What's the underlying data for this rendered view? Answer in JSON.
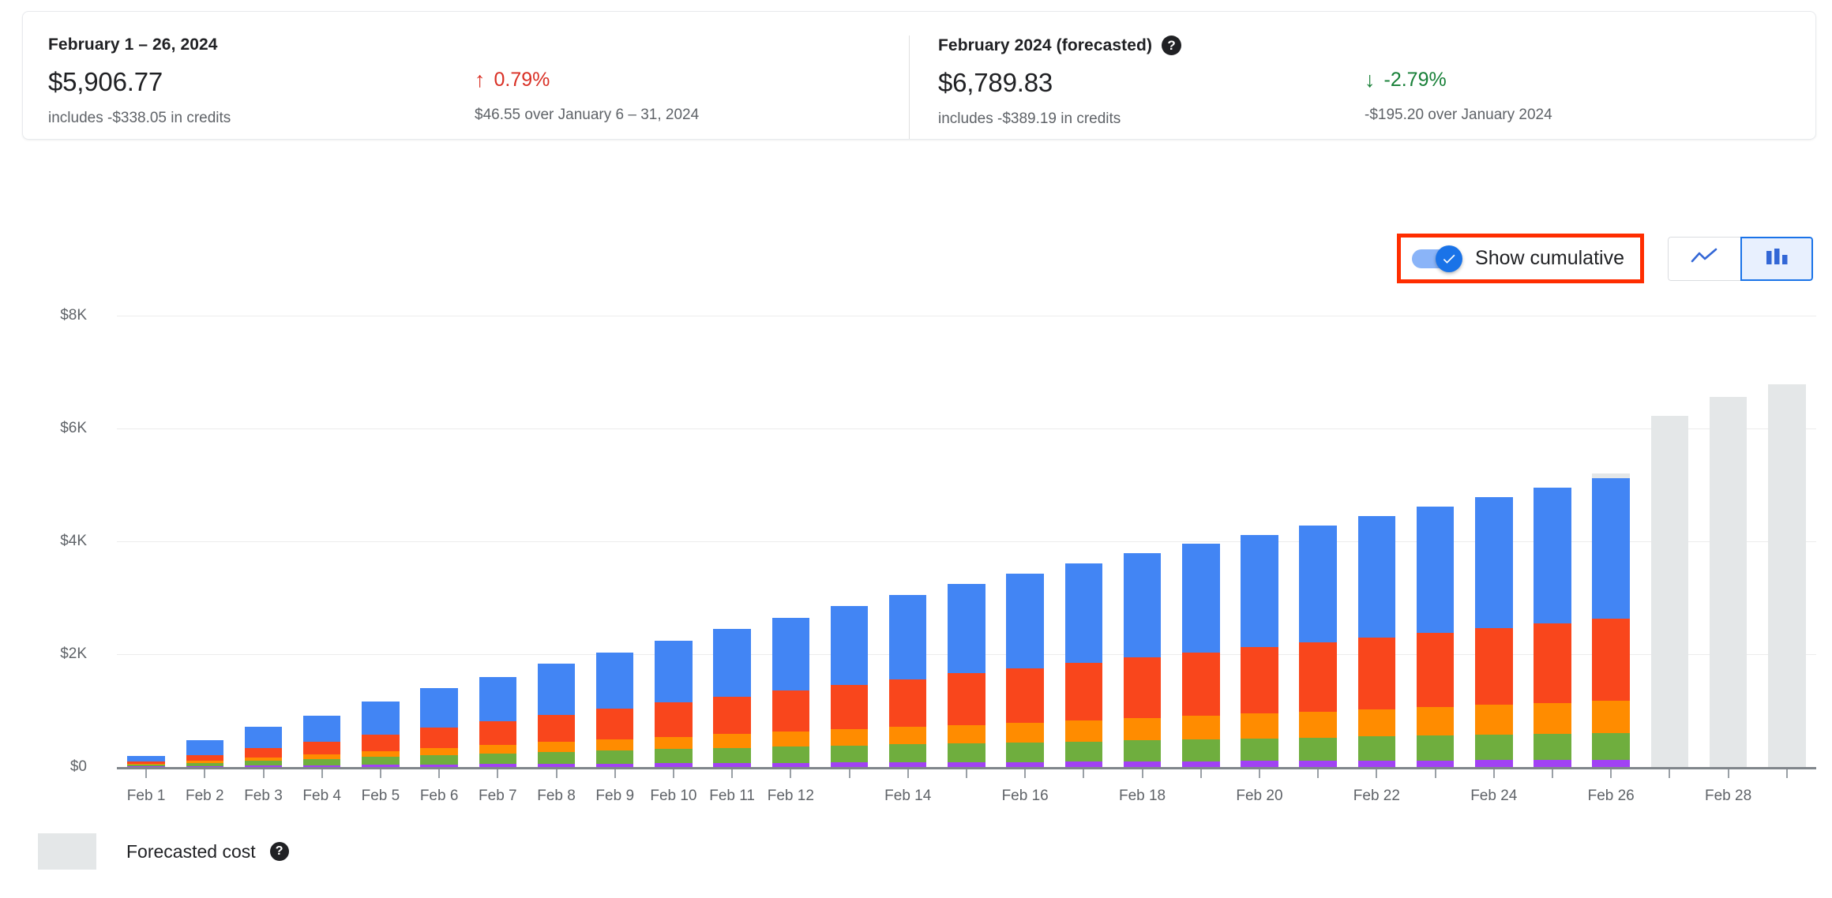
{
  "summary": {
    "actual": {
      "title": "February 1 – 26, 2024",
      "amount": "$5,906.77",
      "credits": "includes -$338.05 in credits",
      "delta_arrow": "↑",
      "delta_pct": "0.79%",
      "delta_direction": "up",
      "delta_color": "#d93025",
      "delta_sub": "$46.55 over January 6 – 31, 2024"
    },
    "forecast": {
      "title": "February 2024 (forecasted)",
      "help_glyph": "?",
      "amount": "$6,789.83",
      "credits": "includes -$389.19 in credits",
      "delta_arrow": "↓",
      "delta_pct": "-2.79%",
      "delta_direction": "down",
      "delta_color": "#188038",
      "delta_sub": "-$195.20 over January 2024"
    }
  },
  "controls": {
    "cumulative_toggle_label": "Show cumulative",
    "cumulative_toggle_on": true,
    "highlight_color": "#ff2d00",
    "line_chart_button": "line-chart",
    "bar_chart_button": "bar-chart",
    "selected_chart_type": "bar"
  },
  "legend": {
    "forecast_label": "Forecasted cost",
    "forecast_color": "#e4e7e8",
    "help_glyph": "?"
  },
  "chart_data": {
    "type": "bar",
    "stacked": true,
    "cumulative": true,
    "title": "",
    "xlabel": "",
    "ylabel": "",
    "ylim": [
      0,
      8000
    ],
    "grid": true,
    "ytick_labels": [
      "$0",
      "$2K",
      "$4K",
      "$6K",
      "$8K"
    ],
    "ytick_values": [
      0,
      2000,
      4000,
      6000,
      8000
    ],
    "legend_position": "bottom-left",
    "categories": [
      "Feb 1",
      "Feb 2",
      "Feb 3",
      "Feb 4",
      "Feb 5",
      "Feb 6",
      "Feb 7",
      "Feb 8",
      "Feb 9",
      "Feb 10",
      "Feb 11",
      "Feb 12",
      "Feb 13",
      "Feb 14",
      "Feb 15",
      "Feb 16",
      "Feb 17",
      "Feb 18",
      "Feb 19",
      "Feb 20",
      "Feb 21",
      "Feb 22",
      "Feb 23",
      "Feb 24",
      "Feb 25",
      "Feb 26",
      "Feb 27",
      "Feb 28",
      "Feb 29"
    ],
    "visible_tick_labels": [
      "Feb 1",
      "Feb 2",
      "Feb 3",
      "Feb 4",
      "Feb 5",
      "Feb 6",
      "Feb 7",
      "Feb 8",
      "Feb 9",
      "Feb 10",
      "Feb 11",
      "Feb 12",
      "",
      "Feb 14",
      "",
      "Feb 16",
      "",
      "Feb 18",
      "",
      "Feb 20",
      "",
      "Feb 22",
      "",
      "Feb 24",
      "",
      "Feb 26",
      "",
      "Feb 28",
      ""
    ],
    "series": [
      {
        "name": "service-purple",
        "color": "#a142f4",
        "values": [
          10,
          18,
          25,
          32,
          38,
          44,
          50,
          56,
          62,
          66,
          70,
          74,
          78,
          82,
          86,
          90,
          94,
          98,
          102,
          106,
          110,
          114,
          118,
          122,
          126,
          130,
          null,
          null,
          null
        ]
      },
      {
        "name": "service-green",
        "color": "#6fae3e",
        "values": [
          30,
          58,
          86,
          112,
          138,
          162,
          186,
          208,
          230,
          250,
          268,
          286,
          302,
          318,
          332,
          346,
          360,
          374,
          388,
          402,
          414,
          426,
          438,
          450,
          462,
          474,
          null,
          null,
          null
        ]
      },
      {
        "name": "service-amber",
        "color": "#ff8c00",
        "values": [
          18,
          40,
          62,
          86,
          110,
          132,
          156,
          178,
          200,
          222,
          244,
          264,
          286,
          308,
          330,
          352,
          374,
          396,
          418,
          440,
          462,
          484,
          506,
          528,
          550,
          572,
          null,
          null,
          null
        ]
      },
      {
        "name": "service-red",
        "color": "#f9461c",
        "values": [
          45,
          100,
          160,
          225,
          290,
          355,
          420,
          485,
          550,
          610,
          670,
          730,
          790,
          850,
          910,
          965,
          1020,
          1075,
          1125,
          1175,
          1220,
          1265,
          1310,
          1360,
          1410,
          1460,
          null,
          null,
          null
        ]
      },
      {
        "name": "service-blue",
        "color": "#4285f4",
        "values": [
          95,
          255,
          380,
          455,
          580,
          700,
          790,
          900,
          980,
          1090,
          1195,
          1290,
          1395,
          1490,
          1585,
          1680,
          1760,
          1850,
          1930,
          1990,
          2070,
          2160,
          2250,
          2330,
          2410,
          2490,
          null,
          null,
          null
        ]
      },
      {
        "name": "forecasted-cost",
        "color": "#e4e7e8",
        "values": [
          null,
          null,
          null,
          null,
          null,
          null,
          null,
          null,
          null,
          null,
          null,
          null,
          null,
          null,
          null,
          null,
          null,
          null,
          null,
          null,
          null,
          null,
          null,
          null,
          null,
          80,
          6230,
          6560,
          6790
        ]
      }
    ],
    "cumulative_totals": [
      198,
      471,
      713,
      910,
      1156,
      1393,
      1602,
      1827,
      2022,
      2238,
      2447,
      2644,
      2851,
      3048,
      3243,
      3433,
      3608,
      3793,
      3963,
      4113,
      4276,
      4449,
      4622,
      4790,
      4958,
      5126,
      6230,
      6560,
      6790
    ]
  }
}
